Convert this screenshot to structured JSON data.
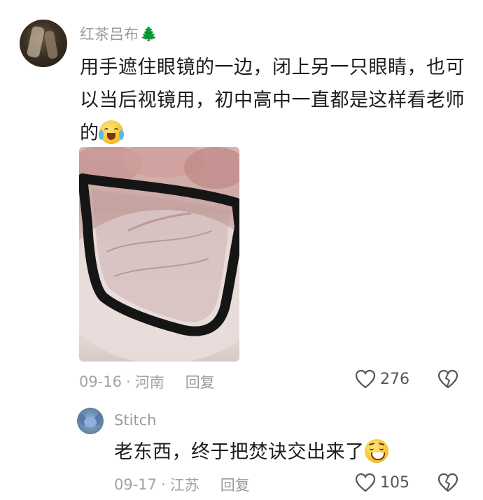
{
  "comment": {
    "username": "红茶吕布",
    "username_icon": "evergreen-tree-icon",
    "text": "用手遮住眼镜的一边，闭上另一只眼睛，也可以当后视镜用，初中高中一直都是这样看老师的",
    "emoji": "crying-laughing-face-icon",
    "date": "09-16",
    "location": "河南",
    "separator": "·",
    "reply_label": "回复",
    "likes": "276"
  },
  "reply": {
    "username": "Stitch",
    "text": "老东西，终于把焚诀交出来了",
    "emoji": "grinning-face-icon",
    "date": "09-17",
    "location": "江苏",
    "separator": "·",
    "reply_label": "回复",
    "likes": "105"
  }
}
